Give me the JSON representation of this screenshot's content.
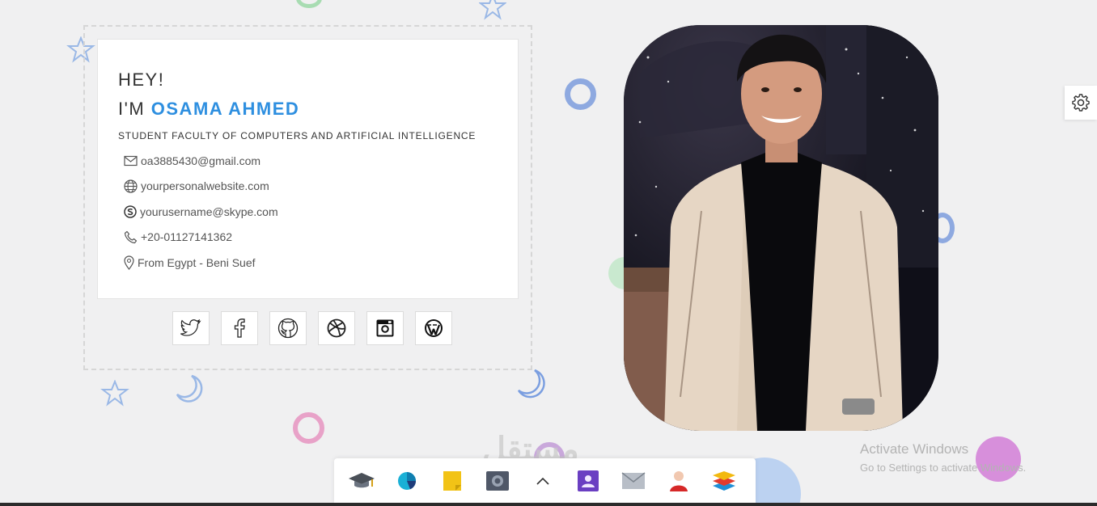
{
  "profile": {
    "greeting": "HEY!",
    "im_prefix": "I'M ",
    "name": "OSAMA AHMED",
    "subtitle": "STUDENT FACULTY OF COMPUTERS AND ARTIFICIAL INTELLIGENCE"
  },
  "contacts": [
    {
      "icon": "mail-icon",
      "text": "oa3885430@gmail.com"
    },
    {
      "icon": "globe-icon",
      "text": "yourpersonalwebsite.com"
    },
    {
      "icon": "skype-icon",
      "text": "yourusername@skype.com"
    },
    {
      "icon": "phone-icon",
      "text": "+20-01127141362"
    },
    {
      "icon": "location-pin-icon",
      "text": "From Egypt - Beni Suef"
    }
  ],
  "socials": [
    "twitter-icon",
    "facebook-icon",
    "github-icon",
    "dribbble-icon",
    "instagram-icon",
    "wordpress-icon"
  ],
  "watermark": {
    "title": "Activate Windows",
    "subtitle": "Go to Settings to activate Windows.",
    "brand": "مستقل"
  },
  "dock": [
    "graduation-cap-icon",
    "pie-chart-icon",
    "sticky-note-icon",
    "safe-icon",
    "chevron-up-icon",
    "contacts-icon",
    "mail-icon",
    "user-icon",
    "layers-icon"
  ],
  "colors": {
    "accent": "#2e8fe0",
    "background": "#f0f0f1"
  }
}
